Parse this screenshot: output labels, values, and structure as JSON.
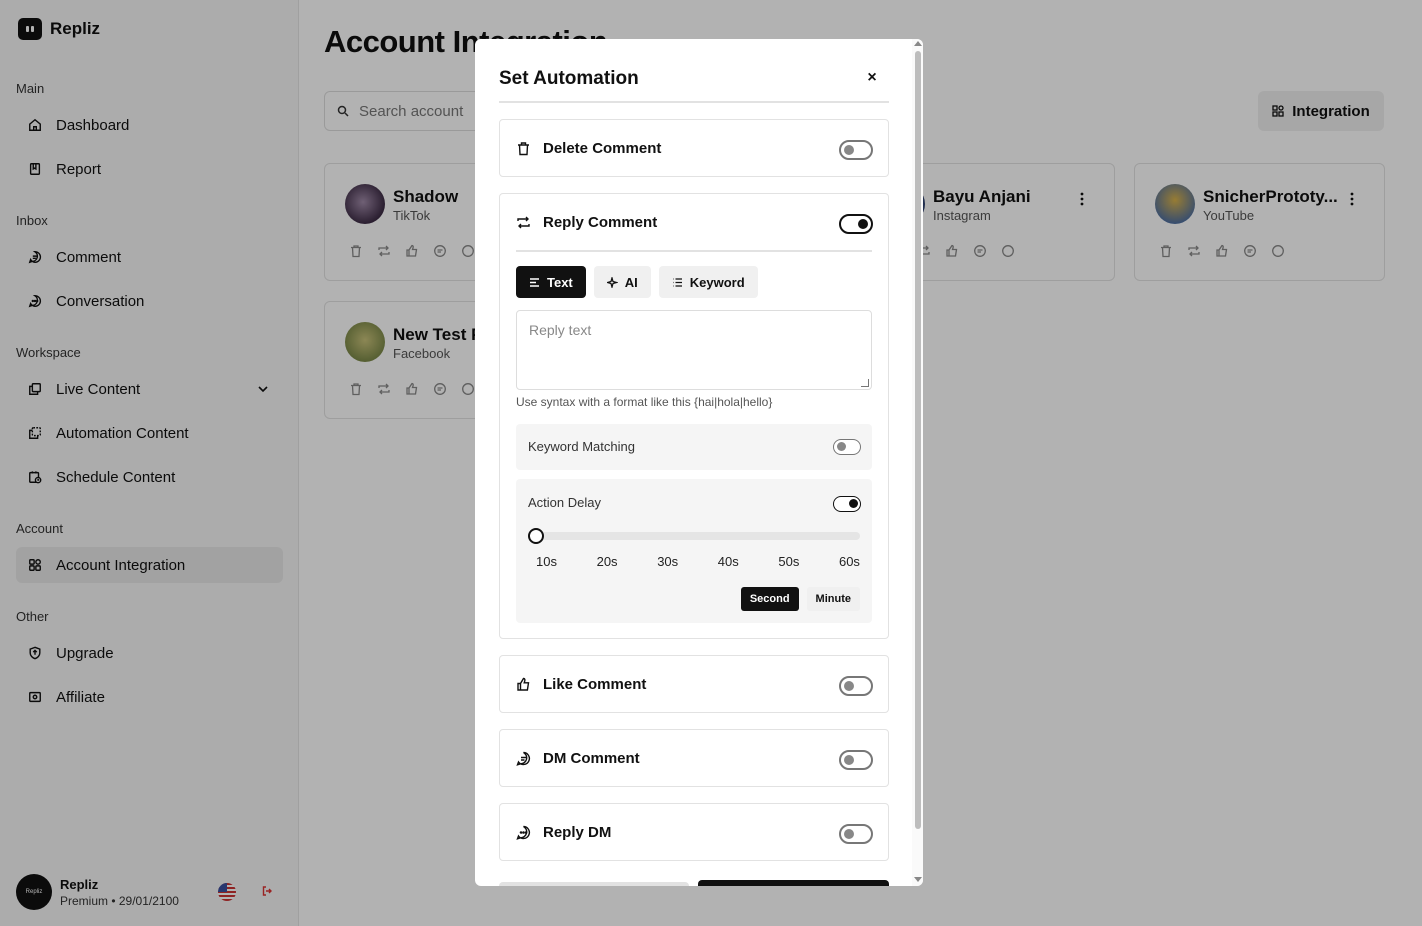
{
  "brand": {
    "name": "Repliz"
  },
  "sidebar": {
    "sections": {
      "main": "Main",
      "inbox": "Inbox",
      "workspace": "Workspace",
      "account": "Account",
      "other": "Other"
    },
    "items": {
      "dashboard": "Dashboard",
      "report": "Report",
      "comment": "Comment",
      "conversation": "Conversation",
      "live_content": "Live Content",
      "automation_content": "Automation Content",
      "schedule_content": "Schedule Content",
      "account_integration": "Account Integration",
      "upgrade": "Upgrade",
      "affiliate": "Affiliate"
    },
    "profile": {
      "name": "Repliz",
      "plan": "Premium • 29/01/2100",
      "avatar_text": "Repliz"
    }
  },
  "main": {
    "title": "Account Integration",
    "search_placeholder": "Search account",
    "integration_button": "Integration",
    "cards": [
      {
        "name": "Shadow",
        "platform": "TikTok"
      },
      {
        "name": "Bayu Anjani",
        "platform": "Instagram"
      },
      {
        "name": "SnicherPrototy...",
        "platform": "YouTube"
      },
      {
        "name": "New Test P",
        "platform": "Facebook"
      }
    ]
  },
  "modal": {
    "title": "Set Automation",
    "close": "×",
    "delete_comment": {
      "label": "Delete Comment",
      "enabled": false
    },
    "reply_comment": {
      "label": "Reply Comment",
      "enabled": true,
      "tabs": [
        "Text",
        "AI",
        "Keyword"
      ],
      "active_tab": "Text",
      "reply_placeholder": "Reply text",
      "hint": "Use syntax with a format like this {hai|hola|hello}",
      "keyword_matching": {
        "label": "Keyword Matching",
        "enabled": false
      },
      "action_delay": {
        "label": "Action Delay",
        "enabled": true,
        "ticks": [
          "10s",
          "20s",
          "30s",
          "40s",
          "50s",
          "60s"
        ],
        "value": "10s",
        "units": [
          "Second",
          "Minute"
        ],
        "active_unit": "Second"
      }
    },
    "like_comment": {
      "label": "Like Comment",
      "enabled": false
    },
    "dm_comment": {
      "label": "DM Comment",
      "enabled": false
    },
    "reply_dm": {
      "label": "Reply DM",
      "enabled": false
    }
  },
  "colors": {
    "accent": "#111111",
    "overlay": "rgba(0,0,0,0.30)",
    "sidebar_bg": "#f7f7f7"
  }
}
